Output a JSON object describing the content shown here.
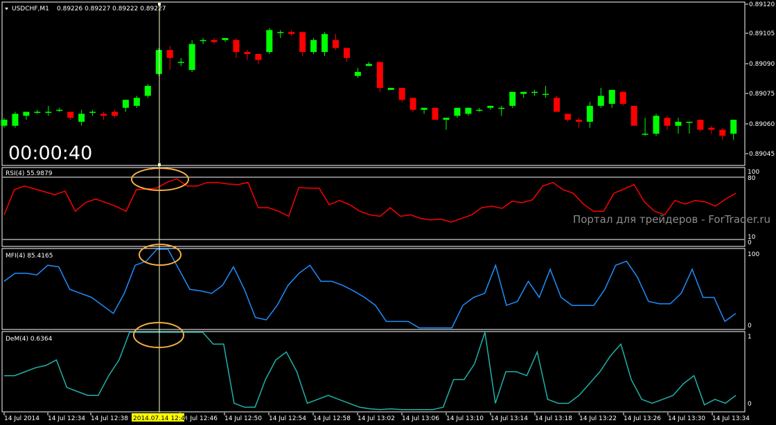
{
  "main": {
    "symbol": "USDCHF,M1",
    "ohlc": "0.89226 0.89227 0.89222 0.89227",
    "timer": "00:00:40",
    "price_ticks": [
      "0.89120",
      "0.89105",
      "0.89090",
      "0.89075",
      "0.89060",
      "0.89045"
    ]
  },
  "rsi": {
    "label": "RSI(4) 55.9879",
    "ticks": [
      "100",
      "80",
      "10",
      "0"
    ]
  },
  "mfi": {
    "label": "MFI(4) 85.4165",
    "ticks": [
      "100",
      "0"
    ]
  },
  "dem": {
    "label": "DeM(4) 0.6364",
    "ticks": [
      "1",
      "0"
    ]
  },
  "watermark": "Портал для трейдеров - ForTrader.ru",
  "time_axis": {
    "labels": [
      "14 Jul 2014",
      "14 Jul 12:34",
      "14 Jul 12:38",
      "14 Jul 12:46",
      "14 Jul 12:50",
      "14 Jul 12:54",
      "14 Jul 12:58",
      "14 Jul 13:02",
      "14 Jul 13:06",
      "14 Jul 13:10",
      "14 Jul 13:14",
      "14 Jul 13:18",
      "14 Jul 13:22",
      "14 Jul 13:26",
      "14 Jul 13:30",
      "14 Jul 13:34"
    ],
    "cursor_label": "2014.07.14 12:44"
  },
  "colors": {
    "bull": "#00ff00",
    "bear": "#ff0000",
    "rsi": "#ff0000",
    "mfi": "#1e90ff",
    "dem": "#20b2aa",
    "cursor": "#ffffcc",
    "highlight": "#f5b042",
    "cursor_label_bg": "#ffff00"
  },
  "chart_data": [
    {
      "type": "candlestick",
      "title": "USDCHF,M1",
      "ylim": [
        0.8904,
        0.8912
      ],
      "cursor_index": 14,
      "series": [
        {
          "o": 0.89059,
          "h": 0.89063,
          "l": 0.89058,
          "c": 0.89062
        },
        {
          "o": 0.89059,
          "h": 0.89066,
          "l": 0.89058,
          "c": 0.89065
        },
        {
          "o": 0.89064,
          "h": 0.89066,
          "l": 0.89062,
          "c": 0.89066
        },
        {
          "o": 0.89066,
          "h": 0.89067,
          "l": 0.89065,
          "c": 0.89066
        },
        {
          "o": 0.89066,
          "h": 0.89069,
          "l": 0.89064,
          "c": 0.89066
        },
        {
          "o": 0.89067,
          "h": 0.89068,
          "l": 0.89066,
          "c": 0.89067
        },
        {
          "o": 0.89066,
          "h": 0.89066,
          "l": 0.89062,
          "c": 0.89063
        },
        {
          "o": 0.89061,
          "h": 0.89067,
          "l": 0.89059,
          "c": 0.89065
        },
        {
          "o": 0.89066,
          "h": 0.89067,
          "l": 0.89064,
          "c": 0.89066
        },
        {
          "o": 0.89065,
          "h": 0.89066,
          "l": 0.89062,
          "c": 0.89064
        },
        {
          "o": 0.89066,
          "h": 0.89067,
          "l": 0.89063,
          "c": 0.89064
        },
        {
          "o": 0.89068,
          "h": 0.89072,
          "l": 0.89066,
          "c": 0.89072
        },
        {
          "o": 0.89069,
          "h": 0.89074,
          "l": 0.89068,
          "c": 0.89073
        },
        {
          "o": 0.89074,
          "h": 0.8908,
          "l": 0.89073,
          "c": 0.89079
        },
        {
          "o": 0.89085,
          "h": 0.89098,
          "l": 0.89084,
          "c": 0.89097
        },
        {
          "o": 0.89097,
          "h": 0.89099,
          "l": 0.89087,
          "c": 0.89093
        },
        {
          "o": 0.89091,
          "h": 0.89093,
          "l": 0.89089,
          "c": 0.89091
        },
        {
          "o": 0.89087,
          "h": 0.89102,
          "l": 0.89086,
          "c": 0.891
        },
        {
          "o": 0.89102,
          "h": 0.89103,
          "l": 0.891,
          "c": 0.89102
        },
        {
          "o": 0.89102,
          "h": 0.89103,
          "l": 0.891,
          "c": 0.89101
        },
        {
          "o": 0.89102,
          "h": 0.89103,
          "l": 0.89101,
          "c": 0.89103
        },
        {
          "o": 0.89102,
          "h": 0.89103,
          "l": 0.89093,
          "c": 0.89096
        },
        {
          "o": 0.89096,
          "h": 0.89097,
          "l": 0.89092,
          "c": 0.89095
        },
        {
          "o": 0.89095,
          "h": 0.89095,
          "l": 0.8909,
          "c": 0.89092
        },
        {
          "o": 0.89096,
          "h": 0.89108,
          "l": 0.89095,
          "c": 0.89107
        },
        {
          "o": 0.89106,
          "h": 0.89107,
          "l": 0.89103,
          "c": 0.89106
        },
        {
          "o": 0.89106,
          "h": 0.89107,
          "l": 0.89104,
          "c": 0.89105
        },
        {
          "o": 0.89106,
          "h": 0.89106,
          "l": 0.89094,
          "c": 0.89096
        },
        {
          "o": 0.89096,
          "h": 0.89103,
          "l": 0.89095,
          "c": 0.89102
        },
        {
          "o": 0.89096,
          "h": 0.89106,
          "l": 0.89094,
          "c": 0.89105
        },
        {
          "o": 0.89102,
          "h": 0.89105,
          "l": 0.89097,
          "c": 0.89098
        },
        {
          "o": 0.89098,
          "h": 0.89098,
          "l": 0.89091,
          "c": 0.89093
        },
        {
          "o": 0.89084,
          "h": 0.89088,
          "l": 0.89083,
          "c": 0.89086
        },
        {
          "o": 0.89089,
          "h": 0.89091,
          "l": 0.89089,
          "c": 0.8909
        },
        {
          "o": 0.89091,
          "h": 0.89091,
          "l": 0.89076,
          "c": 0.89078
        },
        {
          "o": 0.89077,
          "h": 0.89078,
          "l": 0.89077,
          "c": 0.89078
        },
        {
          "o": 0.89078,
          "h": 0.89078,
          "l": 0.89071,
          "c": 0.89072
        },
        {
          "o": 0.89073,
          "h": 0.89073,
          "l": 0.89066,
          "c": 0.89067
        },
        {
          "o": 0.89067,
          "h": 0.89068,
          "l": 0.89065,
          "c": 0.89068
        },
        {
          "o": 0.89068,
          "h": 0.89068,
          "l": 0.89062,
          "c": 0.89062
        },
        {
          "o": 0.89062,
          "h": 0.89063,
          "l": 0.89057,
          "c": 0.89063
        },
        {
          "o": 0.89064,
          "h": 0.89068,
          "l": 0.89063,
          "c": 0.89068
        },
        {
          "o": 0.89065,
          "h": 0.89068,
          "l": 0.89064,
          "c": 0.89068
        },
        {
          "o": 0.89067,
          "h": 0.89068,
          "l": 0.89066,
          "c": 0.89067
        },
        {
          "o": 0.89068,
          "h": 0.89069,
          "l": 0.89067,
          "c": 0.89069
        },
        {
          "o": 0.89068,
          "h": 0.89069,
          "l": 0.89064,
          "c": 0.89068
        },
        {
          "o": 0.89069,
          "h": 0.89076,
          "l": 0.89068,
          "c": 0.89076
        },
        {
          "o": 0.89075,
          "h": 0.89076,
          "l": 0.89073,
          "c": 0.89076
        },
        {
          "o": 0.89076,
          "h": 0.89077,
          "l": 0.89074,
          "c": 0.89076
        },
        {
          "o": 0.89075,
          "h": 0.89079,
          "l": 0.89073,
          "c": 0.89075
        },
        {
          "o": 0.89073,
          "h": 0.89074,
          "l": 0.89066,
          "c": 0.89066
        },
        {
          "o": 0.89065,
          "h": 0.89065,
          "l": 0.89061,
          "c": 0.89062
        },
        {
          "o": 0.89062,
          "h": 0.89063,
          "l": 0.89058,
          "c": 0.89061
        },
        {
          "o": 0.89061,
          "h": 0.89071,
          "l": 0.89058,
          "c": 0.89069
        },
        {
          "o": 0.89069,
          "h": 0.89078,
          "l": 0.89068,
          "c": 0.89074
        },
        {
          "o": 0.8907,
          "h": 0.89077,
          "l": 0.89068,
          "c": 0.89077
        },
        {
          "o": 0.89076,
          "h": 0.89076,
          "l": 0.89069,
          "c": 0.8907
        },
        {
          "o": 0.89069,
          "h": 0.89069,
          "l": 0.89059,
          "c": 0.89059
        },
        {
          "o": 0.89055,
          "h": 0.89063,
          "l": 0.89054,
          "c": 0.89055
        },
        {
          "o": 0.89055,
          "h": 0.89065,
          "l": 0.89054,
          "c": 0.89064
        },
        {
          "o": 0.89063,
          "h": 0.89064,
          "l": 0.89057,
          "c": 0.89059
        },
        {
          "o": 0.89059,
          "h": 0.89063,
          "l": 0.89055,
          "c": 0.89061
        },
        {
          "o": 0.89061,
          "h": 0.89061,
          "l": 0.89055,
          "c": 0.89061
        },
        {
          "o": 0.89062,
          "h": 0.89062,
          "l": 0.89056,
          "c": 0.89057
        },
        {
          "o": 0.89058,
          "h": 0.89059,
          "l": 0.89055,
          "c": 0.89057
        },
        {
          "o": 0.89057,
          "h": 0.89058,
          "l": 0.89052,
          "c": 0.89054
        },
        {
          "o": 0.89055,
          "h": 0.89062,
          "l": 0.89052,
          "c": 0.89062
        }
      ]
    },
    {
      "type": "line",
      "title": "RSI(4) 55.9879",
      "ylim": [
        0,
        100
      ],
      "levels": [
        80,
        10
      ],
      "series": [
        {
          "values": [
            40,
            75,
            80,
            76,
            72,
            68,
            73,
            45,
            57,
            62,
            57,
            52,
            45,
            75,
            76,
            77,
            85,
            90,
            80,
            80,
            85,
            85,
            83,
            82,
            85,
            50,
            50,
            45,
            38,
            78,
            77,
            77,
            54,
            60,
            54,
            45,
            40,
            38,
            50,
            38,
            40,
            35,
            33,
            34,
            30,
            35,
            40,
            50,
            52,
            49,
            59,
            57,
            61,
            80,
            85,
            75,
            70,
            55,
            45,
            45,
            70,
            76,
            82,
            58,
            45,
            40,
            60,
            55,
            60,
            58,
            52,
            62,
            70
          ]
        }
      ]
    },
    {
      "type": "line",
      "title": "MFI(4) 85.4165",
      "ylim": [
        0,
        100
      ],
      "series": [
        {
          "values": [
            60,
            70,
            70,
            68,
            80,
            78,
            50,
            45,
            40,
            30,
            20,
            45,
            80,
            85,
            100,
            100,
            75,
            50,
            48,
            45,
            55,
            78,
            50,
            15,
            12,
            30,
            55,
            70,
            80,
            60,
            60,
            55,
            48,
            40,
            30,
            10,
            10,
            10,
            2,
            2,
            2,
            2,
            30,
            40,
            45,
            80,
            30,
            35,
            60,
            40,
            75,
            40,
            30,
            30,
            30,
            50,
            80,
            85,
            65,
            35,
            32,
            32,
            45,
            75,
            40,
            40,
            10,
            20
          ]
        }
      ]
    },
    {
      "type": "line",
      "title": "DeM(4) 0.6364",
      "ylim": [
        0,
        1
      ],
      "series": [
        {
          "values": [
            0.45,
            0.45,
            0.5,
            0.55,
            0.58,
            0.65,
            0.3,
            0.25,
            0.2,
            0.2,
            0.45,
            0.65,
            1.0,
            1.0,
            1.0,
            1.0,
            1.0,
            1.0,
            1.0,
            1.0,
            0.85,
            0.85,
            0.1,
            0.05,
            0.05,
            0.4,
            0.65,
            0.75,
            0.5,
            0.1,
            0.15,
            0.2,
            0.15,
            0.1,
            0.05,
            0.03,
            0.02,
            0.03,
            0.02,
            0.02,
            0.02,
            0.02,
            0.05,
            0.4,
            0.4,
            0.6,
            1.0,
            0.1,
            0.5,
            0.5,
            0.45,
            0.75,
            0.15,
            0.1,
            0.1,
            0.2,
            0.35,
            0.5,
            0.7,
            0.85,
            0.4,
            0.15,
            0.1,
            0.15,
            0.2,
            0.35,
            0.45,
            0.08,
            0.15,
            0.1,
            0.2
          ]
        }
      ]
    }
  ]
}
